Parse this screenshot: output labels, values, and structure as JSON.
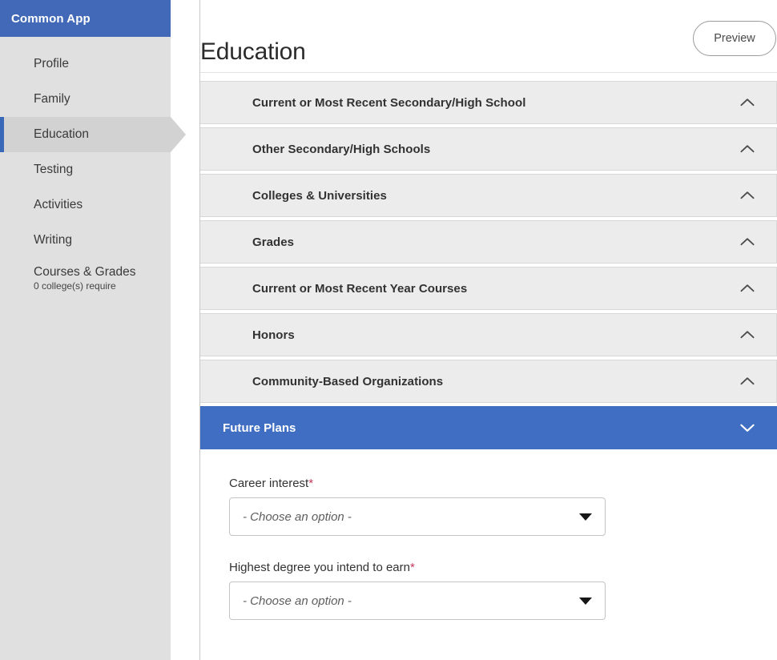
{
  "sidebar": {
    "brand": "Common App",
    "items": [
      {
        "label": "Profile",
        "sub": null,
        "active": false
      },
      {
        "label": "Family",
        "sub": null,
        "active": false
      },
      {
        "label": "Education",
        "sub": null,
        "active": true
      },
      {
        "label": "Testing",
        "sub": null,
        "active": false
      },
      {
        "label": "Activities",
        "sub": null,
        "active": false
      },
      {
        "label": "Writing",
        "sub": null,
        "active": false
      },
      {
        "label": "Courses & Grades",
        "sub": "0 college(s) require",
        "active": false
      }
    ]
  },
  "header": {
    "title": "Education",
    "preview_label": "Preview"
  },
  "accordion": {
    "sections": [
      {
        "title": "Current or Most Recent Secondary/High School",
        "expanded": false,
        "icon": "chevron-up-icon"
      },
      {
        "title": "Other Secondary/High Schools",
        "expanded": false,
        "icon": "chevron-up-icon"
      },
      {
        "title": "Colleges & Universities",
        "expanded": false,
        "icon": "chevron-up-icon"
      },
      {
        "title": "Grades",
        "expanded": false,
        "icon": "chevron-up-icon"
      },
      {
        "title": "Current or Most Recent Year Courses",
        "expanded": false,
        "icon": "chevron-up-icon"
      },
      {
        "title": "Honors",
        "expanded": false,
        "icon": "chevron-up-icon"
      },
      {
        "title": "Community-Based Organizations",
        "expanded": false,
        "icon": "chevron-up-icon"
      },
      {
        "title": "Future Plans",
        "expanded": true,
        "icon": "chevron-down-icon"
      }
    ]
  },
  "form": {
    "fields": [
      {
        "label": "Career interest",
        "required_marker": "*",
        "value": "- Choose an option -",
        "caret": "dropdown-caret-icon"
      },
      {
        "label": "Highest degree you intend to earn",
        "required_marker": "*",
        "value": "- Choose an option -",
        "caret": "dropdown-caret-icon"
      }
    ]
  },
  "colors": {
    "brand_blue": "#4169b8",
    "active_section_blue": "#3f6ec2",
    "sidebar_gray": "#e0e0e0",
    "active_nav_gray": "#d2d2d2",
    "accordion_gray": "#ececec",
    "required_red": "#c2395b"
  }
}
